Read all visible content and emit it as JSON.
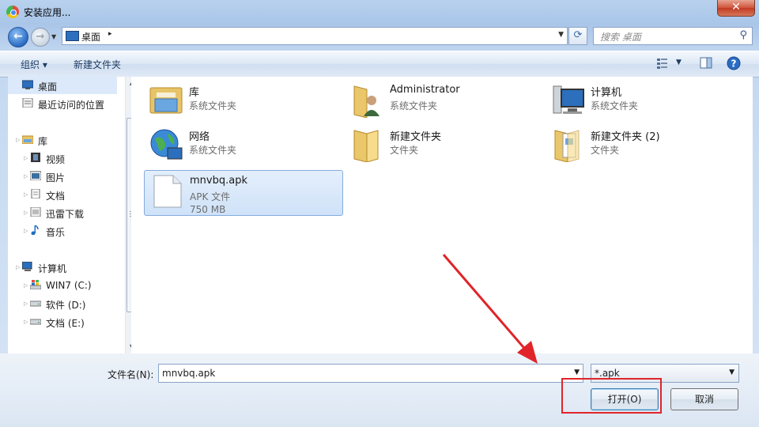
{
  "window": {
    "title": "安装应用...",
    "close_label": "✕"
  },
  "address": {
    "location": "桌面",
    "separator": "▸"
  },
  "search": {
    "placeholder": "搜索 桌面"
  },
  "toolbar": {
    "organize_label": "组织 ▾",
    "new_folder_label": "新建文件夹"
  },
  "nav": {
    "items": [
      {
        "label": "桌面"
      },
      {
        "label": "最近访问的位置"
      },
      {
        "label": "库"
      },
      {
        "label": "视频"
      },
      {
        "label": "图片"
      },
      {
        "label": "文档"
      },
      {
        "label": "迅雷下载"
      },
      {
        "label": "音乐"
      },
      {
        "label": "计算机"
      },
      {
        "label": "WIN7 (C:)"
      },
      {
        "label": "软件 (D:)"
      },
      {
        "label": "文档 (E:)"
      }
    ]
  },
  "files": [
    {
      "name": "库",
      "type": "系统文件夹"
    },
    {
      "name": "Administrator",
      "type": "系统文件夹"
    },
    {
      "name": "计算机",
      "type": "系统文件夹"
    },
    {
      "name": "网络",
      "type": "系统文件夹"
    },
    {
      "name": "新建文件夹",
      "type": "文件夹"
    },
    {
      "name": "新建文件夹 (2)",
      "type": "文件夹"
    },
    {
      "name": "mnvbq.apk",
      "type": "APK 文件",
      "size": "750 MB"
    }
  ],
  "bottom": {
    "filename_label": "文件名(N):",
    "filename_value": "mnvbq.apk",
    "filter_value": "*.apk",
    "open_label": "打开(O)",
    "cancel_label": "取消"
  },
  "colors": {
    "highlight": "#e0242a",
    "selection": "#cfe2f8"
  }
}
